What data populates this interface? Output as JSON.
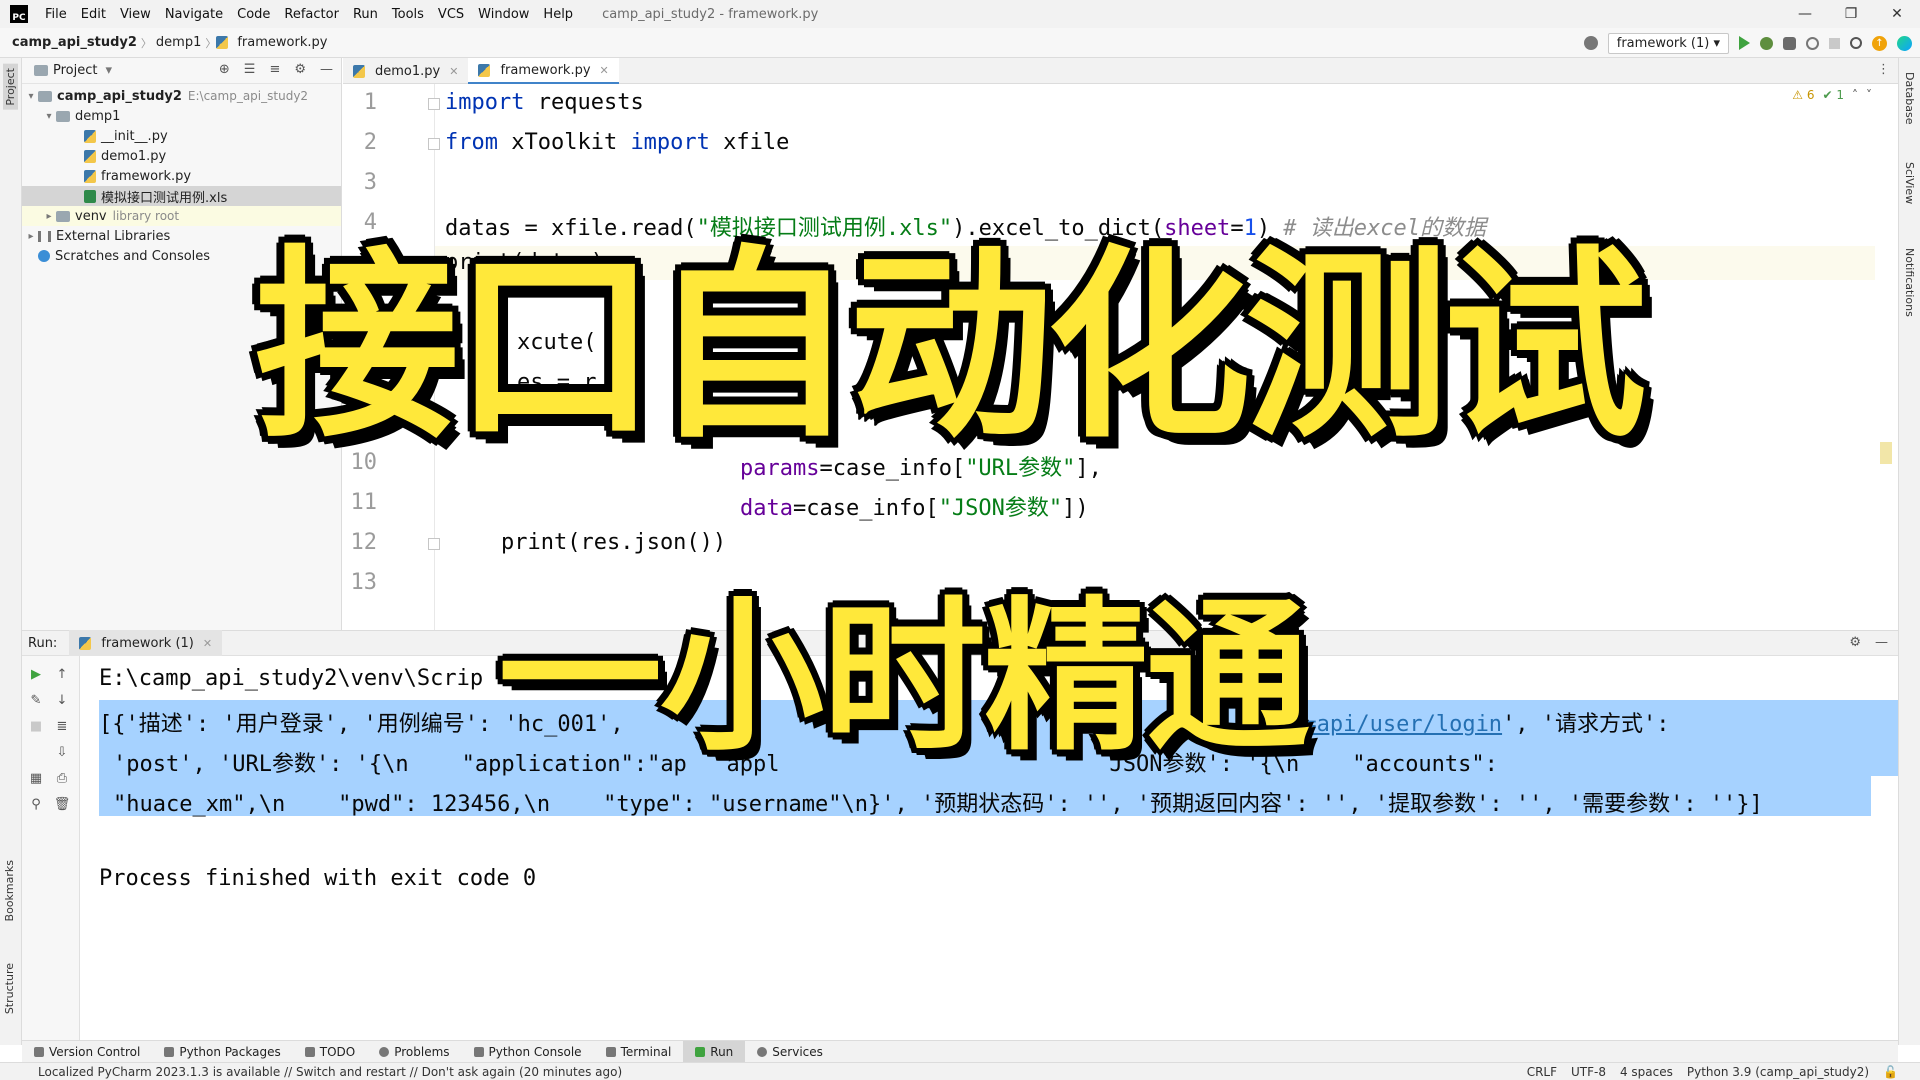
{
  "menubar": {
    "logo": "PC",
    "items": [
      "File",
      "Edit",
      "View",
      "Navigate",
      "Code",
      "Refactor",
      "Run",
      "Tools",
      "VCS",
      "Window",
      "Help"
    ],
    "title": "camp_api_study2 - framework.py",
    "win_min": "—",
    "win_restore": "❐",
    "win_close": "✕"
  },
  "navbar": {
    "project": "camp_api_study2",
    "folder": "demp1",
    "file": "framework.py",
    "run_config": "framework (1)"
  },
  "left_strip": {
    "project": "Project",
    "bookmarks": "Bookmarks",
    "structure": "Structure"
  },
  "right_strip": {
    "database": "Database",
    "sciview": "SciView",
    "notifications": "Notifications"
  },
  "project_panel": {
    "title": "Project",
    "root_name": "camp_api_study2",
    "root_path": "E:\\camp_api_study2",
    "folder": "demp1",
    "files": [
      "__init__.py",
      "demo1.py",
      "framework.py",
      "模拟接口测试用例.xls"
    ],
    "venv": "venv",
    "venv_note": "library root",
    "external": "External Libraries",
    "scratches": "Scratches and Consoles"
  },
  "editor_tabs": {
    "tab1": "demo1.py",
    "tab2": "framework.py"
  },
  "editor": {
    "inspections_warn": "⚠ 6",
    "inspections_ok": "✔ 1",
    "line_numbers": [
      "1",
      "2",
      "3",
      "4",
      "10",
      "11",
      "12",
      "13"
    ],
    "line1": {
      "kw1": "import",
      "rest": " requests"
    },
    "line2": {
      "kw1": "from",
      "mid": " xToolkit ",
      "kw2": "import",
      "rest": " xfile"
    },
    "line4": {
      "a": "datas = xfile.read(",
      "s": "\"模拟接口测试用例.xls\"",
      "b": ").excel_to_dict(",
      "p": "sheet",
      "eq": "=",
      "n": "1",
      "c": ")",
      "cmt": " # 读出excel的数据"
    },
    "line5_partial": "print(datas)",
    "line7_partial": "xcute(",
    "line8_partial": "es = r",
    "line10": {
      "p": "params",
      "a": "=case_info[",
      "s": "\"URL参数\"",
      "b": "],"
    },
    "line11": {
      "p": "data",
      "a": "=case_info[",
      "s": "\"JSON参数\"",
      "b": "])"
    },
    "line12": "print(res.json())"
  },
  "run_panel": {
    "label": "Run:",
    "tab": "framework (1)",
    "console": {
      "path": "E:\\camp_api_study2\\venv\\Scrip",
      "out1_a": "[{'描述': '用户登录', '用例编号': 'hc_001',",
      "out1_link": "p?s=api/user/login",
      "out1_b": "', '请求方式':",
      "out2_a": "'post', 'URL参数': '{\\n    \"application\":\"ap  \"appl",
      "out2_b": "JSON参数': '{\\n    \"accounts\":",
      "out3": "\"huace_xm\",\\n    \"pwd\": 123456,\\n    \"type\": \"username\"\\n}', '预期状态码': '', '预期返回内容': '', '提取参数': '', '需要参数': ''}]",
      "exit": "Process finished with exit code 0"
    }
  },
  "bottom_tabs": [
    "Version Control",
    "Python Packages",
    "TODO",
    "Problems",
    "Python Console",
    "Terminal",
    "Run",
    "Services"
  ],
  "status_bar": {
    "message": "Localized PyCharm 2023.1.3 is available // Switch and restart // Don't ask again (20 minutes ago)",
    "line_sep": "CRLF",
    "encoding": "UTF-8",
    "indent": "4 spaces",
    "interpreter": "Python 3.9 (camp_api_study2)"
  },
  "overlay": {
    "title_1": "接口自动化测试",
    "title_2": "一小时精通",
    "color": "#ffe83a"
  }
}
